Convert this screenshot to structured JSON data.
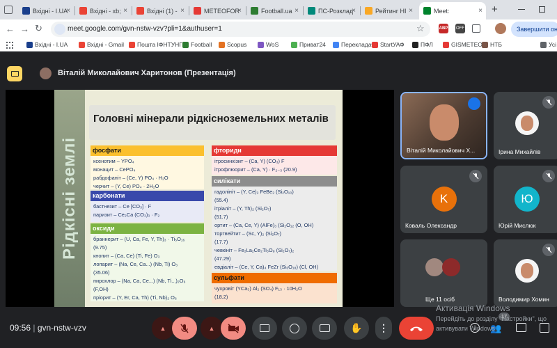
{
  "browser": {
    "tabs": [
      {
        "label": "Вхідні - I.UA",
        "icon": "iua-icon",
        "color": "#1a3f8c"
      },
      {
        "label": "Вхідні - xb;",
        "icon": "gmail-icon",
        "color": "#ea4335"
      },
      {
        "label": "Вхідні (1) -",
        "icon": "gmail-icon",
        "color": "#ea4335"
      },
      {
        "label": "METEOFOR",
        "icon": "meteofor-icon",
        "color": "#e53935"
      },
      {
        "label": "Football.ua",
        "icon": "football-icon",
        "color": "#2e7d32"
      },
      {
        "label": "ПС-Розклад",
        "icon": "schedule-icon",
        "color": "#00897b"
      },
      {
        "label": "Рейтинг НІ",
        "icon": "rating-icon",
        "color": "#f9a825"
      },
      {
        "label": "Meet:",
        "icon": "meet-icon",
        "color": "#00832d"
      }
    ],
    "new_tab": "+",
    "url": "meet.google.com/gvn-nstw-vzv?pli=1&authuser=1",
    "finish_update": "Завершити оно",
    "bookmarks": [
      {
        "label": "Вхідні - I.UA",
        "color": "#1a3f8c"
      },
      {
        "label": "Вхідні - Gmail",
        "color": "#ea4335"
      },
      {
        "label": "Пошта ІФНТУНГ",
        "color": "#ea4335"
      },
      {
        "label": "Football",
        "color": "#2e7d32"
      },
      {
        "label": "Scopus",
        "color": "#e37222"
      },
      {
        "label": "WoS",
        "color": "#7e57c2"
      },
      {
        "label": "Приват24",
        "color": "#4caf50"
      },
      {
        "label": "Перекладач",
        "color": "#4285f4"
      },
      {
        "label": "StartУАФ",
        "color": "#e53935"
      },
      {
        "label": "ПФЛ",
        "color": "#222222"
      },
      {
        "label": "GISMETEO",
        "color": "#e53935"
      },
      {
        "label": "НТБ",
        "color": "#795548"
      },
      {
        "label": "Усі",
        "color": "#5f6368"
      }
    ]
  },
  "meet": {
    "presenter_label": "Віталій Миколайович Харитонов (Презентація)",
    "slide": {
      "vertical_title": "Рідкісні землі",
      "title": "Головні мінерали рідкісноземельних металів",
      "left": [
        {
          "header": "фосфати",
          "lines": [
            "ксенотим – YPO₄",
            "монацит – CePO₄",
            "рабдофаніт – (Ce, Y) PO₄ · H₂O",
            "черчит – (Y, Ce) PO₄ · 2H₂O"
          ]
        },
        {
          "header": "карбонати",
          "lines": [
            "бастнезит – Ce [CO₃] · F",
            "паризит – Ce₂Ca (CO₃)₃ · F₂"
          ]
        },
        {
          "header": "оксиди",
          "lines": [
            "браннерит – (U, Ca, Fe, Y, Th)₃ · Ti₅O₁₆",
            "(9.75)",
            "кнопит – (Ca, Ce) (Ti, Fe) O₃",
            "лопарит – (Na, Ce, Ca...) (Nb, Ti) O₃",
            "(35.06)",
            "пирохлор – (Na, Ca, Ce...) (Nb, Ti...)₂O₆",
            "(F,OH)",
            "пріорит – (Y, Er, Ca, Th) (Ti, Nb)₂ O₆"
          ]
        }
      ],
      "right": [
        {
          "header": "фториди",
          "lines": [
            "ітросинхізит – (Ca, Y) (CO₃) F",
            "ітрофлюорит – (Ca, Y) · F₂₋₃ (20.9)"
          ]
        },
        {
          "header": "силікати",
          "lines": [
            "гадолініт – (Y, Ce)₂ FeBe₂ (Si₂O₁₀)",
            "(55.4)",
            "ітріаліт – (Y, Th)₂ (Si₂O₇)",
            "(51.7)",
            "ортит – (Ca, Ce, Y) (AlFe)₃ (Si₂O₁₂ (O, OH)",
            "тортвейтит – (Sc, Y)₂ (Si₂O₇)",
            "(17.7)",
            "чевкініт – Fe₂La₂Ce₂Ti₃O₈ (Si₂O₇)₂",
            "(47.29)",
            "евдіаліт – (Ce, Y, Ca)₄ FeZr (Si₆O₁₈) (Cl, OH)"
          ]
        },
        {
          "header": "сульфати",
          "lines": [
            "чухровіт (YCa₃) Al₂ (SO₄) F₁₃ · 10H₂O",
            "(18.2)"
          ]
        }
      ]
    },
    "participants": [
      {
        "name": "Віталій Миколайович Х...",
        "kind": "video"
      },
      {
        "name": "Ірина Михайлів",
        "kind": "photo"
      },
      {
        "name": "Коваль Олександр",
        "initial": "K",
        "color": "#e8710a"
      },
      {
        "name": "Юрій Мислюк",
        "initial": "Ю",
        "color": "#12b5cb"
      },
      {
        "name": "Ще 11 осіб",
        "kind": "group"
      },
      {
        "name": "Володимир Хомин",
        "kind": "photo"
      }
    ],
    "clock": "09:56",
    "meeting_code": "gvn-nstw-vzv",
    "participant_count": "17",
    "windows_watermark": [
      "Активація Windows",
      "Перейдіть до розділу \"Настройки\", що",
      "активувати Windows."
    ]
  }
}
